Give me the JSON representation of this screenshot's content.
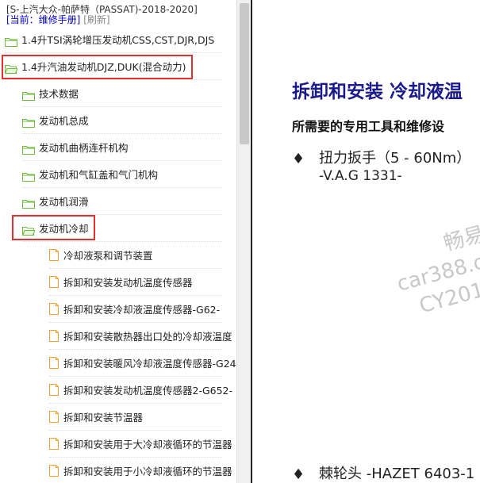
{
  "tree": {
    "app_title": "[S-上汽大众-帕萨特（PASSAT)-2018-2020]",
    "current_label": "[当前：维修手册]",
    "refresh_label": "[刷新]",
    "items": [
      {
        "label": "1.4升TSI涡轮增压发动机CSS,CST,DJR,DJS",
        "type": "folder"
      },
      {
        "label": "1.4升汽油发动机DJZ,DUK(混合动力)",
        "type": "folder-open"
      },
      {
        "label": "技术数据",
        "type": "folder"
      },
      {
        "label": "发动机总成",
        "type": "folder"
      },
      {
        "label": "发动机曲柄连杆机构",
        "type": "folder"
      },
      {
        "label": "发动机和气缸盖和气门机构",
        "type": "folder"
      },
      {
        "label": "发动机润滑",
        "type": "folder"
      },
      {
        "label": "发动机冷却",
        "type": "folder-open"
      },
      {
        "label": "冷却液泵和调节装置",
        "type": "doc"
      },
      {
        "label": "拆卸和安装发动机温度传感器",
        "type": "doc"
      },
      {
        "label": "拆卸和安装冷却液温度传感器-G62-",
        "type": "doc"
      },
      {
        "label": "拆卸和安装散热器出口处的冷却液温度",
        "type": "doc"
      },
      {
        "label": "拆卸和安装暖风冷却液温度传感器-G24",
        "type": "doc"
      },
      {
        "label": "拆卸和安装发动机温度传感器2-G652-",
        "type": "doc"
      },
      {
        "label": "拆卸和安装节温器",
        "type": "doc"
      },
      {
        "label": "拆卸和安装用于大冷却液循环的节温器",
        "type": "doc"
      },
      {
        "label": "拆卸和安装用于小冷却液循环的节温器",
        "type": "doc"
      }
    ]
  },
  "content": {
    "title": "拆卸和安装 冷却液温",
    "subtitle": "所需要的专用工具和维修设",
    "bullet_symbol": "♦",
    "tool1_line1": "扭力扳手（5 - 60Nm）",
    "tool1_line2": "-V.A.G 1331-",
    "tool2": "棘轮头 -HAZET 6403-1",
    "watermark_line1": "畅易",
    "watermark_line2": "car388.c",
    "watermark_line3": "CY201"
  },
  "colors": {
    "highlight": "#e03030",
    "title_blue": "#1a1a8c",
    "folder_green": "#6cbb3c",
    "doc_orange": "#f0a030"
  }
}
